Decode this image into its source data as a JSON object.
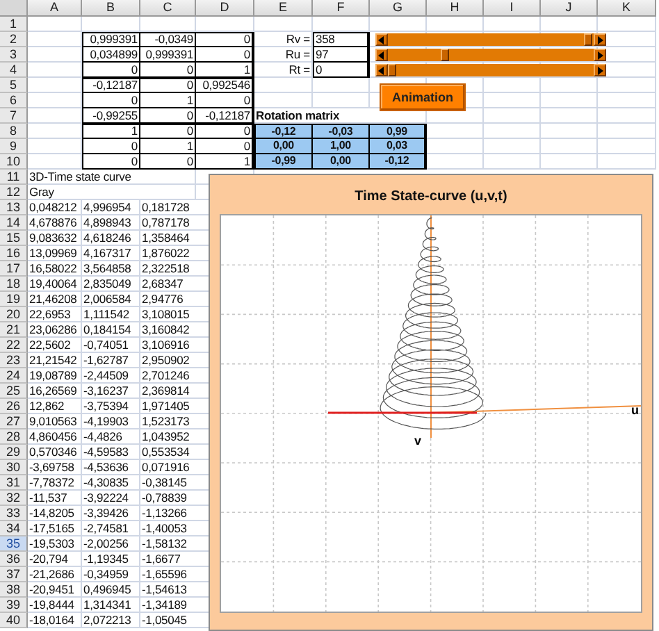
{
  "columns": [
    "A",
    "B",
    "C",
    "D",
    "E",
    "F",
    "G",
    "H",
    "I",
    "J",
    "K"
  ],
  "rows": [
    {
      "n": "1",
      "selected": false
    },
    {
      "n": "2",
      "selected": false,
      "cells": [
        null,
        "0,999391",
        "-0,0349",
        "0",
        "Rv =",
        "358"
      ]
    },
    {
      "n": "3",
      "selected": false,
      "cells": [
        null,
        "0,034899",
        "0,999391",
        "0",
        "Ru =",
        "97"
      ]
    },
    {
      "n": "4",
      "selected": false,
      "cells": [
        null,
        "0",
        "0",
        "1",
        "Rt =",
        "0"
      ]
    },
    {
      "n": "5",
      "selected": false,
      "cells": [
        null,
        "-0,12187",
        "0",
        "0,992546"
      ]
    },
    {
      "n": "6",
      "selected": false,
      "cells": [
        null,
        "0",
        "1",
        "0"
      ]
    },
    {
      "n": "7",
      "selected": false,
      "cells": [
        null,
        "-0,99255",
        "0",
        "-0,12187",
        "Rotation matrix"
      ]
    },
    {
      "n": "8",
      "selected": false,
      "cells": [
        null,
        "1",
        "0",
        "0",
        "-0,12",
        "-0,03",
        "0,99"
      ]
    },
    {
      "n": "9",
      "selected": false,
      "cells": [
        null,
        "0",
        "1",
        "0",
        "0,00",
        "1,00",
        "0,03"
      ]
    },
    {
      "n": "10",
      "selected": false,
      "cells": [
        null,
        "0",
        "0",
        "1",
        "-0,99",
        "0,00",
        "-0,12"
      ]
    },
    {
      "n": "11",
      "selected": false,
      "cells": [
        "3D-Time state curve"
      ]
    },
    {
      "n": "12",
      "selected": false,
      "cells": [
        "Gray"
      ]
    },
    {
      "n": "13",
      "selected": false,
      "cells": [
        "0,048212",
        "4,996954",
        "0,181728"
      ]
    },
    {
      "n": "14",
      "selected": false,
      "cells": [
        "4,678876",
        "4,898943",
        "0,787178"
      ]
    },
    {
      "n": "15",
      "selected": false,
      "cells": [
        "9,083632",
        "4,618246",
        "1,358464"
      ]
    },
    {
      "n": "16",
      "selected": false,
      "cells": [
        "13,09969",
        "4,167317",
        "1,876022"
      ]
    },
    {
      "n": "17",
      "selected": false,
      "cells": [
        "16,58022",
        "3,564858",
        "2,322518"
      ]
    },
    {
      "n": "18",
      "selected": false,
      "cells": [
        "19,40064",
        "2,835049",
        "2,68347"
      ]
    },
    {
      "n": "19",
      "selected": false,
      "cells": [
        "21,46208",
        "2,006584",
        "2,94776"
      ]
    },
    {
      "n": "20",
      "selected": false,
      "cells": [
        "22,6953",
        "1,111542",
        "3,108015"
      ]
    },
    {
      "n": "21",
      "selected": false,
      "cells": [
        "23,06286",
        "0,184154",
        "3,160842"
      ]
    },
    {
      "n": "22",
      "selected": false,
      "cells": [
        "22,5602",
        "-0,74051",
        "3,106916"
      ]
    },
    {
      "n": "23",
      "selected": false,
      "cells": [
        "21,21542",
        "-1,62787",
        "2,950902"
      ]
    },
    {
      "n": "24",
      "selected": false,
      "cells": [
        "19,08789",
        "-2,44509",
        "2,701246"
      ]
    },
    {
      "n": "25",
      "selected": false,
      "cells": [
        "16,26569",
        "-3,16237",
        "2,369814"
      ]
    },
    {
      "n": "26",
      "selected": false,
      "cells": [
        "12,862",
        "-3,75394",
        "1,971405"
      ]
    },
    {
      "n": "27",
      "selected": false,
      "cells": [
        "9,010563",
        "-4,19903",
        "1,523173"
      ]
    },
    {
      "n": "28",
      "selected": false,
      "cells": [
        "4,860456",
        "-4,4826",
        "1,043952"
      ]
    },
    {
      "n": "29",
      "selected": false,
      "cells": [
        "0,570346",
        "-4,59583",
        "0,553534"
      ]
    },
    {
      "n": "30",
      "selected": false,
      "cells": [
        "-3,69758",
        "-4,53636",
        "0,071916"
      ]
    },
    {
      "n": "31",
      "selected": false,
      "cells": [
        "-7,78372",
        "-4,30835",
        "-0,38145"
      ]
    },
    {
      "n": "32",
      "selected": false,
      "cells": [
        "-11,537",
        "-3,92224",
        "-0,78839"
      ]
    },
    {
      "n": "33",
      "selected": false,
      "cells": [
        "-14,8205",
        "-3,39426",
        "-1,13266"
      ]
    },
    {
      "n": "34",
      "selected": false,
      "cells": [
        "-17,5165",
        "-2,74581",
        "-1,40053"
      ]
    },
    {
      "n": "35",
      "selected": true,
      "cells": [
        "-19,5303",
        "-2,00256",
        "-1,58132"
      ]
    },
    {
      "n": "36",
      "selected": false,
      "cells": [
        "-20,794",
        "-1,19345",
        "-1,6677"
      ]
    },
    {
      "n": "37",
      "selected": false,
      "cells": [
        "-21,2686",
        "-0,34959",
        "-1,65596"
      ]
    },
    {
      "n": "38",
      "selected": false,
      "cells": [
        "-20,9451",
        "0,496945",
        "-1,54613"
      ]
    },
    {
      "n": "39",
      "selected": false,
      "cells": [
        "-19,8444",
        "1,314341",
        "-1,34189"
      ]
    },
    {
      "n": "40",
      "selected": false,
      "cells": [
        "-18,0164",
        "2,072213",
        "-1,05045"
      ]
    }
  ],
  "sliders": [
    {
      "level": 0.99
    },
    {
      "level": 0.27
    },
    {
      "level": 0
    }
  ],
  "animation_button": {
    "label": "Animation"
  },
  "chart": {
    "title": "Time State-curve (u,v,t)",
    "u_label": "u",
    "v_label": "v"
  }
}
